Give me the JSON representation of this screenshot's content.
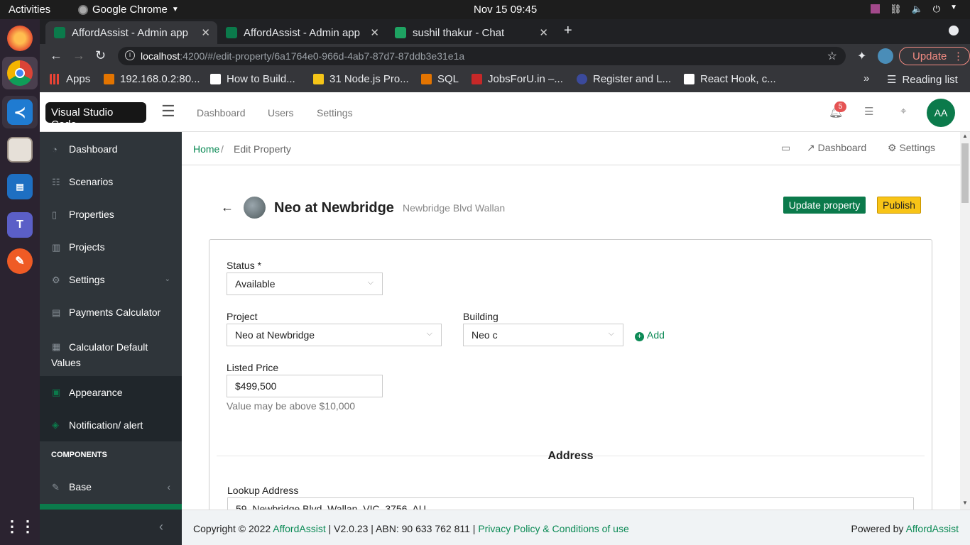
{
  "system": {
    "activities": "Activities",
    "app_name": "Google Chrome",
    "clock": "Nov 15  09:45"
  },
  "tooltip": "Visual Studio Code",
  "browser": {
    "tabs": [
      {
        "title": "AffordAssist - Admin app"
      },
      {
        "title": "AffordAssist - Admin app"
      },
      {
        "title": "sushil thakur - Chat"
      }
    ],
    "url_host": "localhost",
    "url_rest": ":4200/#/edit-property/6a1764e0-966d-4ab7-87d7-87ddb3e31e1a",
    "update_label": "Update",
    "bookmarks": [
      "Apps",
      "192.168.0.2:80...",
      "How to Build...",
      "31 Node.js Pro...",
      "SQL",
      "JobsForU.in –...",
      "Register and L...",
      "React Hook, c..."
    ],
    "reading_list": "Reading list"
  },
  "header": {
    "nav": [
      "Dashboard",
      "Users",
      "Settings"
    ],
    "notif_count": "5",
    "avatar": "AA"
  },
  "sidebar": {
    "items": [
      {
        "label": "Dashboard",
        "icon": "speedometer-icon"
      },
      {
        "label": "Scenarios",
        "icon": "list-icon"
      },
      {
        "label": "Properties",
        "icon": "building-icon"
      },
      {
        "label": "Projects",
        "icon": "bar-chart-icon"
      },
      {
        "label": "Settings",
        "icon": "gear-icon"
      },
      {
        "label": "Payments Calculator",
        "icon": "document-icon"
      },
      {
        "label": "Calculator Default Values",
        "icon": "calculator-icon"
      },
      {
        "label": "Appearance",
        "icon": "palette-icon"
      },
      {
        "label": "Notification/ alert",
        "icon": "tag-icon"
      }
    ],
    "section_title": "COMPONENTS",
    "base": "Base"
  },
  "breadcrumb": {
    "home": "Home",
    "current": "Edit Property",
    "actions": [
      "Dashboard",
      "Settings"
    ]
  },
  "property": {
    "title": "Neo at Newbridge",
    "subtitle": "Newbridge Blvd Wallan",
    "update_btn": "Update property",
    "publish_btn": "Publish"
  },
  "form": {
    "status_label": "Status *",
    "status_value": "Available",
    "project_label": "Project",
    "project_value": "Neo at Newbridge",
    "building_label": "Building",
    "building_value": "Neo c",
    "add_label": "Add",
    "price_label": "Listed Price",
    "price_value": "$499,500",
    "price_hint": "Value may be above $10,000",
    "address_heading": "Address",
    "lookup_label": "Lookup Address",
    "lookup_value": "59, Newbridge Blvd, Wallan, VIC, 3756, AU"
  },
  "footer": {
    "copyright": "Copyright © 2022",
    "brand": "AffordAssist",
    "version": "| V2.0.23 | ABN: 90 633 762 811 |",
    "policy": "Privacy Policy & Conditions of use",
    "powered": "Powered by"
  },
  "colors": {
    "accent": "#0b7a4b",
    "publish": "#f8c417",
    "sidebar": "#2f353a"
  }
}
